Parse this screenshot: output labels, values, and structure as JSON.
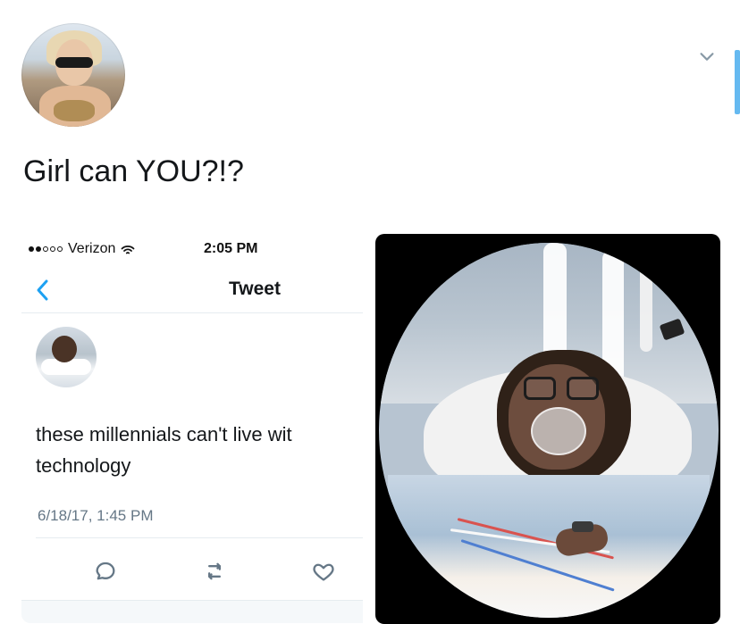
{
  "post": {
    "caption": "Girl can YOU?!?"
  },
  "left_screenshot": {
    "status_bar": {
      "carrier": "Verizon",
      "time": "2:05 PM"
    },
    "nav": {
      "title": "Tweet"
    },
    "tweet": {
      "text_line_1": "these millennials can't live wit",
      "text_line_2": "technology",
      "timestamp": "6/18/17, 1:45 PM"
    }
  },
  "icons": {
    "chevron": "chevron-down-icon",
    "back": "back-icon",
    "reply": "reply-icon",
    "retweet": "retweet-icon",
    "like": "heart-icon"
  },
  "colors": {
    "accent_blue": "#1da1f2",
    "muted_gray": "#657786",
    "divider": "#e6ecf0"
  }
}
